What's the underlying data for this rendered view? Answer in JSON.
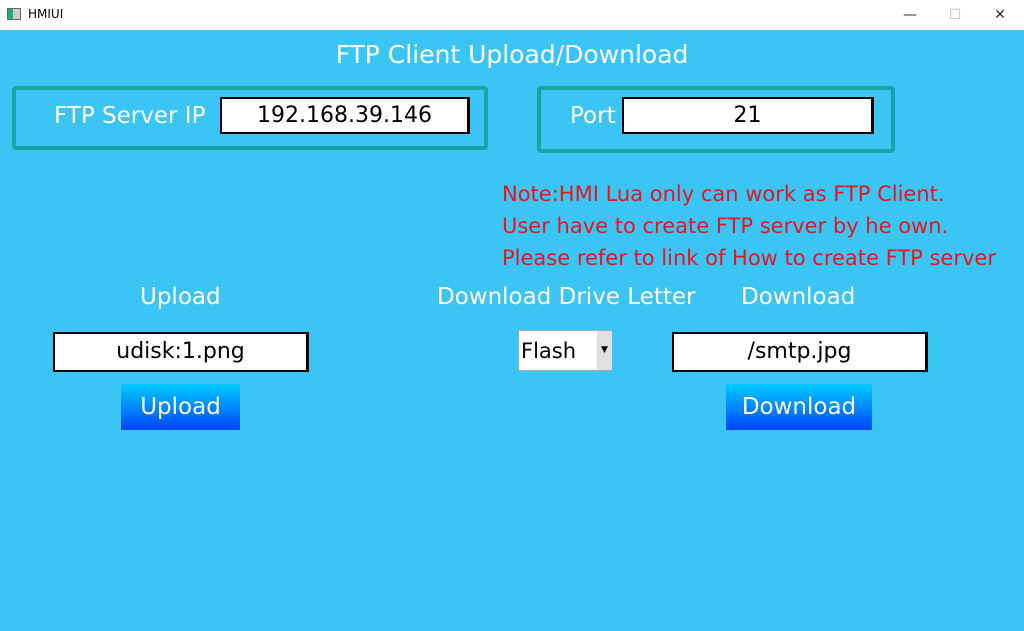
{
  "window": {
    "title": "HMIUI",
    "minimize": "—",
    "maximize": "☐",
    "close": "✕"
  },
  "header": {
    "title": "FTP Client Upload/Download"
  },
  "server": {
    "ip_label": "FTP Server IP",
    "ip_value": "192.168.39.146",
    "port_label": "Port",
    "port_value": "21"
  },
  "notes": [
    "Note:HMI Lua only can work as FTP Client.",
    "User have to create FTP server by he own.",
    "Please refer to link of How to create FTP server"
  ],
  "upload": {
    "label": "Upload",
    "file": "udisk:1.png",
    "button": "Upload"
  },
  "drive": {
    "label": "Download Drive Letter",
    "selected": "Flash"
  },
  "download": {
    "label": "Download",
    "file": "/smtp.jpg",
    "button": "Download"
  },
  "colors": {
    "background": "#3BC5F5",
    "frame": "#17A5A3",
    "note": "#E8141C"
  }
}
